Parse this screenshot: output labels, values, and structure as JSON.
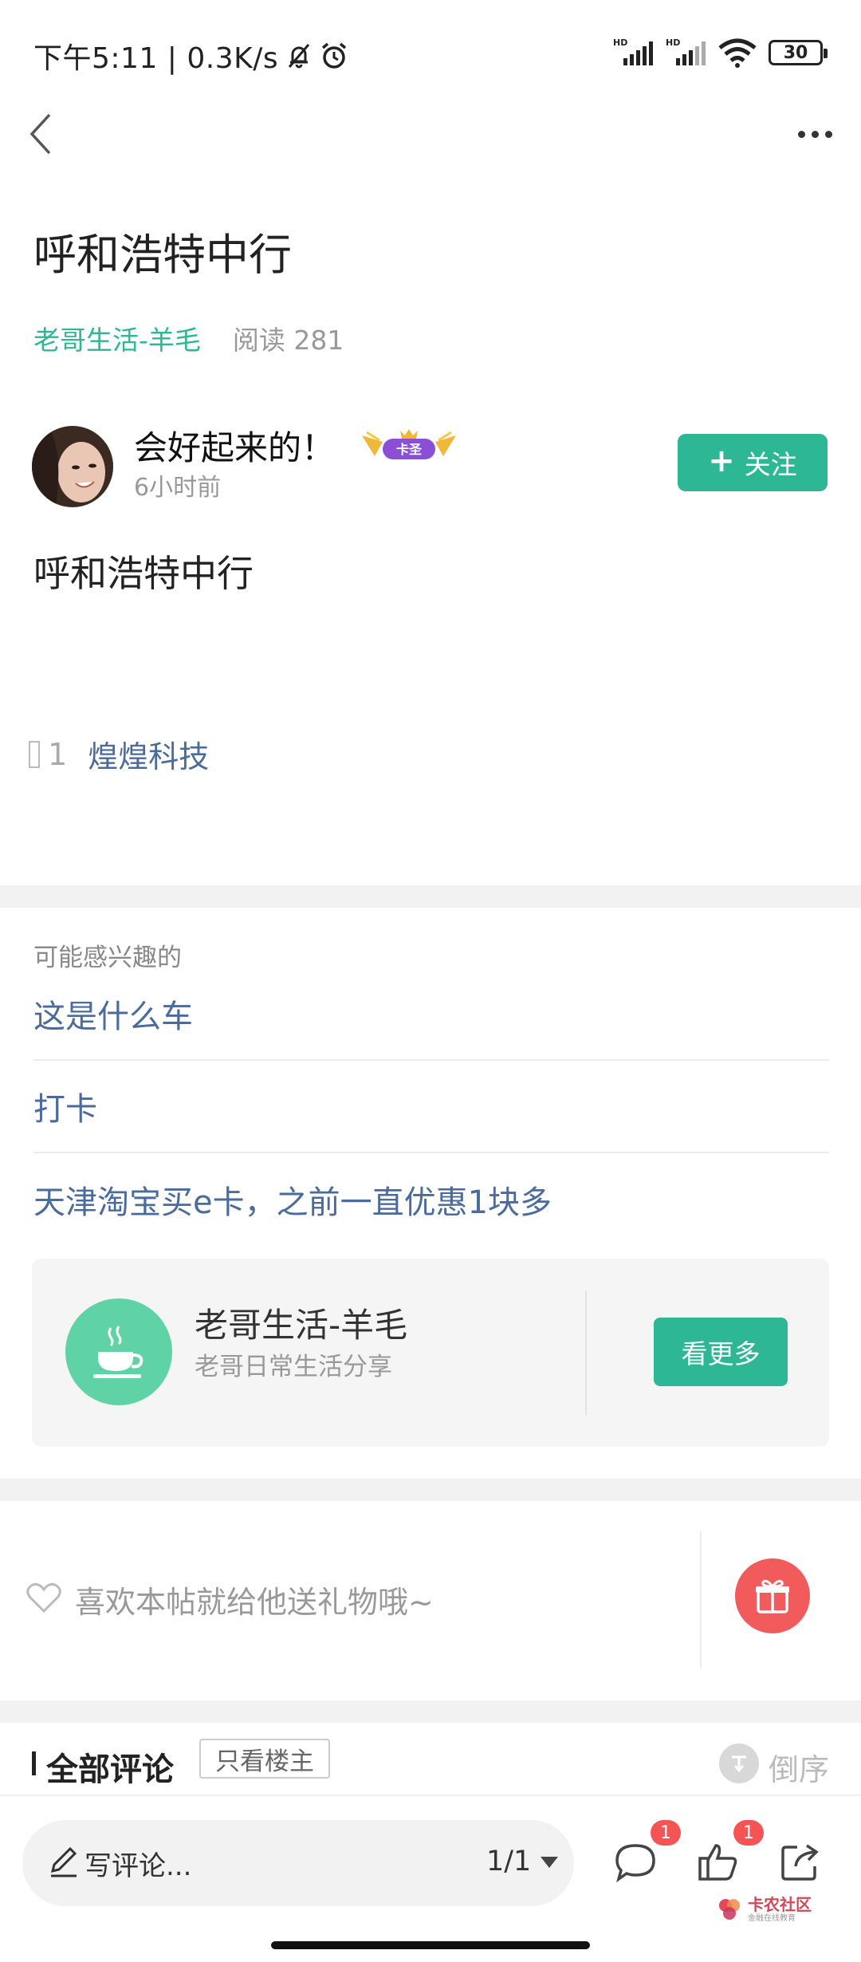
{
  "status_bar": {
    "time": "下午5:11 | 0.3K/s",
    "network_label": "HD",
    "battery": "30"
  },
  "post": {
    "title": "呼和浩特中行",
    "circle": "老哥生活-羊毛",
    "reads": "阅读 281",
    "body": "呼和浩特中行"
  },
  "author": {
    "name": "会好起来的！",
    "badge": "卡圣",
    "time": "6小时前",
    "follow_label": "关注"
  },
  "poll": {
    "count": "1",
    "tag": "煌煌科技"
  },
  "related": {
    "label": "可能感兴趣的",
    "items": [
      {
        "title": "这是什么车"
      },
      {
        "title": "打卡"
      },
      {
        "title": "天津淘宝买e卡，之前一直优惠1块多"
      }
    ]
  },
  "circle_card": {
    "name": "老哥生活-羊毛",
    "desc": "老哥日常生活分享",
    "more_label": "看更多"
  },
  "gift": {
    "prompt": "喜欢本帖就给他送礼物哦~"
  },
  "comments": {
    "title": "全部评论",
    "owner_only_label": "只看楼主",
    "sort_label": "倒序"
  },
  "bottom_bar": {
    "input_placeholder": "写评论...",
    "page_indicator": "1/1",
    "comment_count": "1",
    "like_count": "1"
  },
  "watermark": {
    "name": "卡农社区",
    "sub": "金融在线教育"
  },
  "colors": {
    "accent": "#2db795",
    "link": "#4a6b9b",
    "badge_red": "#f45454",
    "gift_red": "#f25b5b"
  },
  "icons": [
    "back-arrow-icon",
    "more-dots-icon",
    "bell-off-icon",
    "alarm-icon",
    "signal-icon",
    "wifi-icon",
    "battery-icon",
    "plus-icon",
    "cup-icon",
    "heart-icon",
    "gift-icon",
    "sort-icon",
    "pencil-icon",
    "comment-icon",
    "thumbs-up-icon",
    "share-icon"
  ]
}
